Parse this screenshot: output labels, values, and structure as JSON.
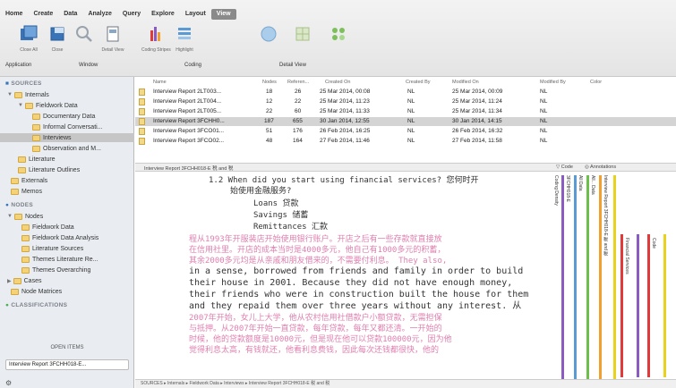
{
  "menu": [
    "Home",
    "Create",
    "Data",
    "Analyze",
    "Query",
    "Explore",
    "Layout",
    "View"
  ],
  "menu_active": "View",
  "toolbar": {
    "close_all": "Close All",
    "close": "Close",
    "detail_view": "Detail View",
    "coding_stripes": "Coding Stripes",
    "highlight": "Highlight",
    "groups": {
      "application": "Application",
      "window": "Window",
      "coding": "Coding",
      "detail_view": "Detail View"
    }
  },
  "sidebar": {
    "sources_head": "SOURCES",
    "internals": "Internals",
    "fieldwork": "Fieldwork Data",
    "documentary": "Documentary Data",
    "informal": "Informal Conversati...",
    "interviews": "Interviews",
    "observation": "Observation and M...",
    "literature": "Literature",
    "literature_outlines": "Literature Outlines",
    "externals": "Externals",
    "memos": "Memos",
    "nodes_head": "NODES",
    "nodes": "Nodes",
    "n_fieldwork": "Fieldwork Data",
    "n_fieldwork_analysis": "Fieldwork Data Analysis",
    "n_lit_sources": "Literature Sources",
    "n_themes_lit": "Themes Literature Re...",
    "n_themes_over": "Themes Overarching",
    "cases": "Cases",
    "node_matrices": "Node Matrices",
    "classifications_head": "CLASSIFICATIONS",
    "open_items": "OPEN ITEMS",
    "open_item": "Interview Report 3FCHH018-E..."
  },
  "table": {
    "headers": {
      "name": "Name",
      "nodes": "Nodes",
      "refs": "Referen...",
      "created_on": "Created On",
      "created_by": "Created By",
      "modified_on": "Modified On",
      "modified_by": "Modified By",
      "color": "Color"
    },
    "rows": [
      {
        "name": "Interview Report 2LT003...",
        "nodes": "18",
        "refs": "26",
        "created_on": "25 Mar 2014, 00:08",
        "created_by": "NL",
        "modified_on": "25 Mar 2014, 00:09",
        "modified_by": "NL"
      },
      {
        "name": "Interview Report 2LT004...",
        "nodes": "12",
        "refs": "22",
        "created_on": "25 Mar 2014, 11:23",
        "created_by": "NL",
        "modified_on": "25 Mar 2014, 11:24",
        "modified_by": "NL"
      },
      {
        "name": "Interview Report 2LT005...",
        "nodes": "22",
        "refs": "60",
        "created_on": "25 Mar 2014, 11:33",
        "created_by": "NL",
        "modified_on": "25 Mar 2014, 11:34",
        "modified_by": "NL"
      },
      {
        "name": "Interview Report 3FCHH0...",
        "nodes": "187",
        "refs": "655",
        "created_on": "30 Jan 2014, 12:55",
        "created_by": "NL",
        "modified_on": "30 Jan 2014, 14:15",
        "modified_by": "NL"
      },
      {
        "name": "Interview Report 3FCO01...",
        "nodes": "51",
        "refs": "176",
        "created_on": "26 Feb 2014, 16:25",
        "created_by": "NL",
        "modified_on": "26 Feb 2014, 16:32",
        "modified_by": "NL"
      },
      {
        "name": "Interview Report 3FCO02...",
        "nodes": "48",
        "refs": "164",
        "created_on": "27 Feb 2014, 11:46",
        "created_by": "NL",
        "modified_on": "27 Feb 2014, 11:58",
        "modified_by": "NL"
      }
    ]
  },
  "docbar": {
    "title": "Interview Report 3FCHH018-E 税 and 税",
    "code": "Code",
    "annotations": "Annotations"
  },
  "doc": {
    "l1": "1.2 When did you start using financial services?  您何时开",
    "l2": "始使用金融服务?",
    "l3": "Loans  贷款",
    "l4": "Savings  储蓄",
    "l5": "Remittances  汇款",
    "l6": "程从1993年开服装店开始使用银行账户。开店之后有一些存款就直接放",
    "l7": "在信用社里。开店的成本当时是4000多元，他自己有1000多元的积蓄，",
    "l8": "其余2000多元均是从亲戚和朋友借来的，不需要付利息。  They also,",
    "l9": "in a sense, borrowed from friends and family in order to build",
    "l10": "their house in 2001.  Because they did not have enough money,",
    "l11": "their friends who were in construction built the house for them",
    "l12": "and they repaid them over three years without any interest. 从",
    "l13": "2007年开始，女儿上大学，他从农村信用社借款户小额贷款，无需担保",
    "l14": "与抵押。从2007年开始一直贷款，每年贷款，每年又都还清。一开始的",
    "l15": "时候，他的贷款额度是10000元，但是现在他可以贷款100000元，因为他",
    "l16": "觉得利息太高，有钱就还，他看利息费钱，因此每次还钱都很快，他的"
  },
  "stripes": {
    "coding_density": "Coding Density",
    "s1": "3FCHH018-E",
    "s2": "All Data",
    "s3": "All... Data",
    "s4": "Interview Report 3FCHH018-E 税 and 税",
    "s5": "Financial Services",
    "s6": "Code"
  },
  "status": "SOURCES ▸ Internals ▸ Fieldwork Data ▸ Interviews ▸ Interview Report 3FCHH018-E 税 and 税",
  "colors": {
    "pink_text": "#e07fb0",
    "stripe_purple": "#8a5cc2",
    "stripe_blue": "#5b9bd5",
    "stripe_green": "#6cc04a",
    "stripe_orange": "#f0a030",
    "stripe_yellow": "#e8d21e",
    "stripe_red": "#e03a3a"
  }
}
